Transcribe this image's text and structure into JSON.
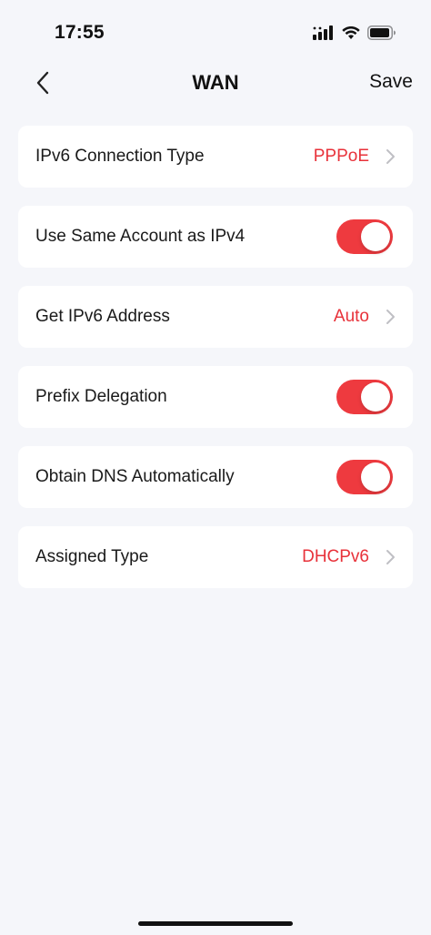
{
  "status_bar": {
    "time": "17:55",
    "icons": [
      "cellular-signal-icon",
      "wifi-icon",
      "battery-icon"
    ]
  },
  "nav": {
    "back_icon": "chevron-left-icon",
    "title": "WAN",
    "save_label": "Save"
  },
  "settings": [
    {
      "label": "IPv6 Connection Type",
      "value": "PPPoE",
      "kind": "select"
    },
    {
      "label": "Use Same Account as IPv4",
      "kind": "toggle",
      "on": true
    },
    {
      "label": "Get IPv6 Address",
      "value": "Auto",
      "kind": "select"
    },
    {
      "label": "Prefix Delegation",
      "kind": "toggle",
      "on": true
    },
    {
      "label": "Obtain DNS Automatically",
      "kind": "toggle",
      "on": true
    },
    {
      "label": "Assigned Type",
      "value": "DHCPv6",
      "kind": "select"
    }
  ],
  "colors": {
    "accent": "#ee3a3f",
    "value_text": "#e8323a",
    "background": "#f5f6fa",
    "card": "#ffffff"
  }
}
